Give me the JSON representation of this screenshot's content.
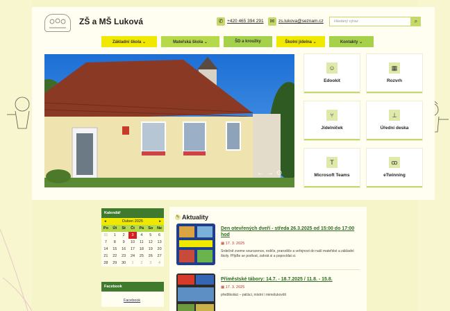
{
  "header": {
    "title": "ZŠ a MŠ Luková",
    "phone": "+420 465 394 291",
    "email": "zs.lukova@seznam.cz",
    "search_placeholder": "Hledaný výraz"
  },
  "nav": [
    {
      "label": "Základní škola  ⌄"
    },
    {
      "label": "Mateřská škola  ⌄"
    },
    {
      "label": "ŠD a kroužky"
    },
    {
      "label": "Školní jídelna  ⌄"
    },
    {
      "label": "Kontakty  ⌄"
    }
  ],
  "tiles": [
    {
      "label": "Edookit",
      "icon": "smile-icon"
    },
    {
      "label": "Rozvrh",
      "icon": "calendar-icon"
    },
    {
      "label": "Jídelníček",
      "icon": "cutlery-icon"
    },
    {
      "label": "Úřední deska",
      "icon": "stamp-icon"
    },
    {
      "label": "Microsoft Teams",
      "icon": "teams-icon"
    },
    {
      "label": "eTwinning",
      "icon": "people-icon"
    }
  ],
  "hero": {
    "prev": "←",
    "next": "→",
    "pause": "⊙"
  },
  "calendar": {
    "title": "Kalendář",
    "month": "Duben 2025",
    "prev": "◂",
    "next": "▸",
    "days": [
      "Po",
      "Út",
      "St",
      "Čt",
      "Pá",
      "So",
      "Ne"
    ],
    "weeks": [
      [
        "31",
        "1",
        "2",
        "3",
        "4",
        "5",
        "6"
      ],
      [
        "7",
        "8",
        "9",
        "10",
        "11",
        "12",
        "13"
      ],
      [
        "14",
        "15",
        "16",
        "17",
        "18",
        "19",
        "20"
      ],
      [
        "21",
        "22",
        "23",
        "24",
        "25",
        "26",
        "27"
      ],
      [
        "28",
        "29",
        "30",
        "1",
        "2",
        "3",
        "4"
      ]
    ],
    "today": "3"
  },
  "facebook": {
    "title": "Facebook",
    "link": "Facebook"
  },
  "news": {
    "title": "Aktuality",
    "articles": [
      {
        "title": "Den otevřených dveří - středa 26.3.2025 od 15:00 do 17:00 hod",
        "date": "17. 3. 2025",
        "text": "Srdečně zveme sourozence, rodiče, prarodiče a veřejnost do naší mateřské a základní školy. Přijďte se podívat, zahrát si a popovídat si."
      },
      {
        "title": "Příměstské tábory: 14.7. - 18.7.2025 / 11.8. - 15.8.",
        "date": "17. 3. 2025",
        "text": "předškoláci – páťáci, místní i mimolukovští"
      }
    ]
  }
}
